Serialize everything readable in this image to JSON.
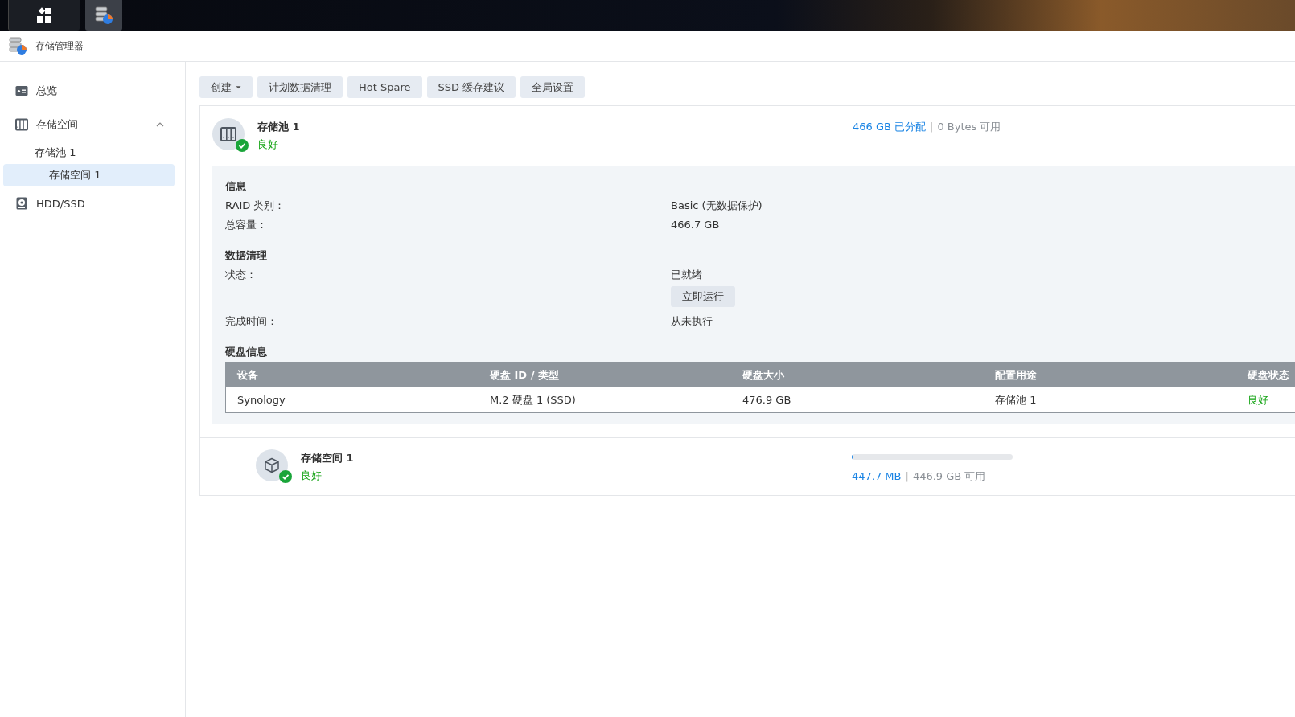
{
  "taskbar": {
    "items": [
      {
        "kind": "launcher",
        "selected": false
      },
      {
        "kind": "storage-app",
        "selected": true
      }
    ]
  },
  "app": {
    "title": "存储管理器"
  },
  "sidebar": {
    "items": [
      {
        "kind": "overview",
        "label": "总览",
        "selected": false
      },
      {
        "kind": "storage",
        "label": "存储空间",
        "selected": false,
        "expanded": true,
        "children": [
          {
            "label": "存储池 1",
            "selected": false,
            "children": [
              {
                "label": "存储空间 1",
                "selected": true
              }
            ]
          }
        ]
      },
      {
        "kind": "disk",
        "label": "HDD/SSD",
        "selected": false
      }
    ]
  },
  "toolbar": {
    "buttons": [
      {
        "label": "创建",
        "dropdown": true
      },
      {
        "label": "计划数据清理",
        "dropdown": false
      },
      {
        "label": "Hot Spare",
        "dropdown": false
      },
      {
        "label": "SSD 缓存建议",
        "dropdown": false
      },
      {
        "label": "全局设置",
        "dropdown": false
      }
    ]
  },
  "pool": {
    "name": "存储池 1",
    "status": "良好",
    "healthy": true,
    "allocated": "466 GB 已分配",
    "separator": "|",
    "available": "0 Bytes 可用",
    "sections": [
      {
        "title": "信息",
        "rows": [
          {
            "label": "RAID 类别：",
            "value": "Basic (无数据保护)"
          },
          {
            "label": "总容量：",
            "value": "466.7 GB"
          }
        ]
      },
      {
        "title": "数据清理",
        "rows": [
          {
            "label": "状态：",
            "value": "已就绪",
            "button": "立即运行"
          },
          {
            "label": "完成时间：",
            "value": "从未执行"
          }
        ]
      }
    ],
    "disks": {
      "title": "硬盘信息",
      "columns": [
        "设备",
        "硬盘 ID / 类型",
        "硬盘大小",
        "配置用途",
        "硬盘状态"
      ],
      "rows": [
        {
          "cells": [
            "Synology",
            "M.2 硬盘 1 (SSD)",
            "476.9 GB",
            "存储池 1"
          ],
          "status": "良好",
          "healthy": true
        }
      ]
    }
  },
  "volume": {
    "name": "存储空间 1",
    "status": "良好",
    "healthy": true,
    "level": 0.01,
    "used": "447.7 MB",
    "separator": "|",
    "available": "446.9 GB 可用"
  }
}
